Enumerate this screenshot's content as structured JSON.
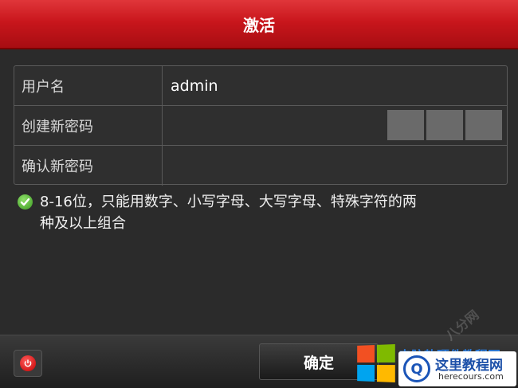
{
  "dialog": {
    "title": "激活"
  },
  "form": {
    "username_label": "用户名",
    "username_value": "admin",
    "new_password_label": "创建新密码",
    "new_password_value": "",
    "confirm_password_label": "确认新密码",
    "confirm_password_value": "",
    "strength_segments": 3
  },
  "hint": {
    "line1": "8-16位，只能用数字、小写字母、大写字母、特殊字符的两",
    "line2": "种及以上组合"
  },
  "footer": {
    "confirm_label": "确定",
    "power_icon": "power-icon"
  },
  "watermark": {
    "blue_text": "电脑软硬件教程网",
    "faint_text": "八分网",
    "badge_main": "这里教程网",
    "badge_sub": "herecours.com",
    "badge_mark": "Q",
    "colors": {
      "win_red": "#f25022",
      "win_green": "#7fba00",
      "win_blue": "#00a4ef",
      "win_yellow": "#ffb900"
    }
  },
  "colors": {
    "title_bar": "#c9161c",
    "background": "#2b2b2b",
    "check": "#4caf2a"
  }
}
